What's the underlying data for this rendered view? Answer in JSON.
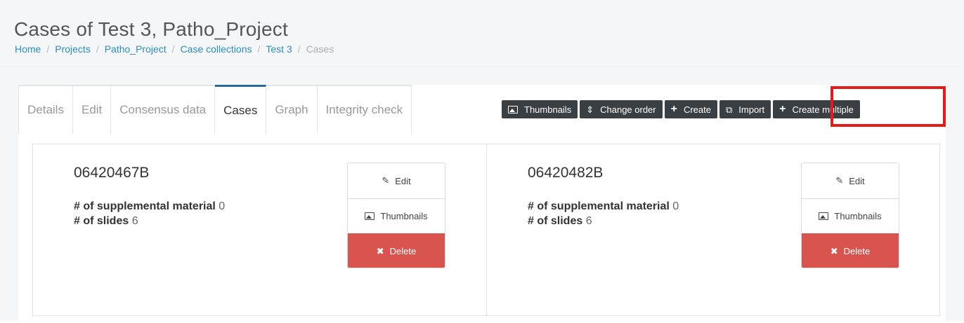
{
  "header": {
    "title": "Cases of Test 3, Patho_Project",
    "breadcrumb": [
      "Home",
      "Projects",
      "Patho_Project",
      "Case collections",
      "Test 3",
      "Cases"
    ]
  },
  "tabs": [
    "Details",
    "Edit",
    "Consensus data",
    "Cases",
    "Graph",
    "Integrity check"
  ],
  "toolbar": {
    "thumbnails": "Thumbnails",
    "change_order": "Change order",
    "create": "Create",
    "import": "Import",
    "create_multiple": "Create multiple"
  },
  "cases": [
    {
      "id": "06420467B",
      "supplemental_label": "# of supplemental material",
      "supplemental_value": "0",
      "slides_label": "# of slides",
      "slides_value": "6",
      "edit": "Edit",
      "thumbnails": "Thumbnails",
      "delete": "Delete"
    },
    {
      "id": "06420482B",
      "supplemental_label": "# of supplemental material",
      "supplemental_value": "0",
      "slides_label": "# of slides",
      "slides_value": "6",
      "edit": "Edit",
      "thumbnails": "Thumbnails",
      "delete": "Delete"
    }
  ],
  "colors": {
    "link": "#2a8fc1",
    "toolbar_button": "#3a3f44",
    "delete_button": "#d9534f",
    "highlight": "#e41b1b"
  }
}
